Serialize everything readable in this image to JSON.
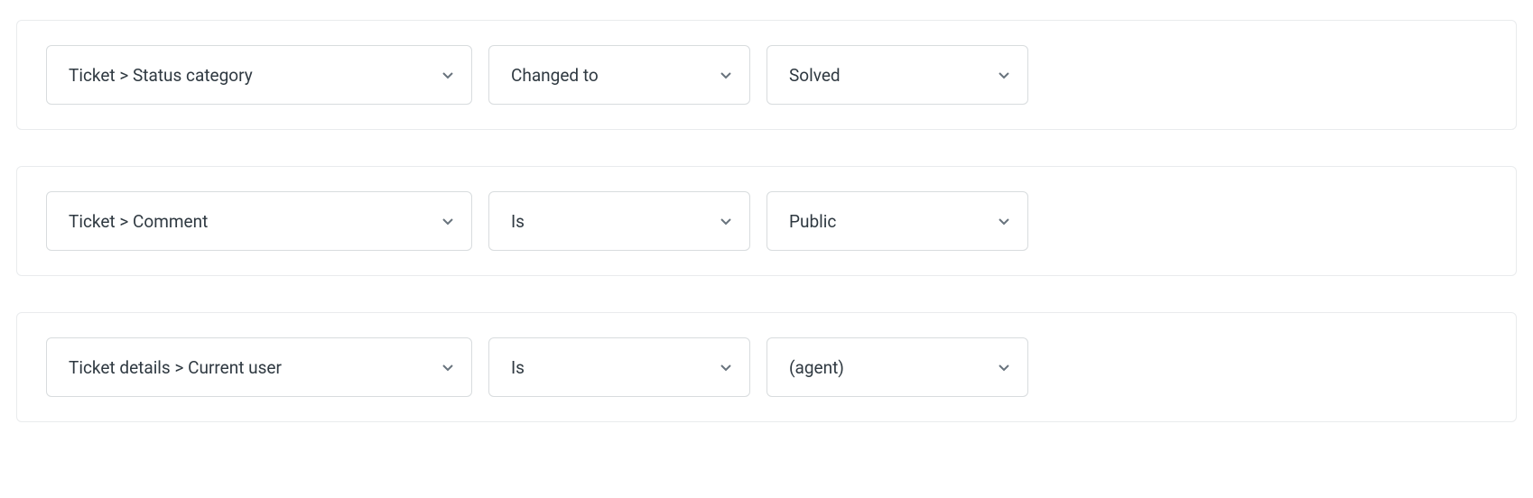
{
  "conditions": [
    {
      "field": "Ticket > Status category",
      "operator": "Changed to",
      "value": "Solved"
    },
    {
      "field": "Ticket > Comment",
      "operator": "Is",
      "value": "Public"
    },
    {
      "field": "Ticket details > Current user",
      "operator": "Is",
      "value": "(agent)"
    }
  ]
}
